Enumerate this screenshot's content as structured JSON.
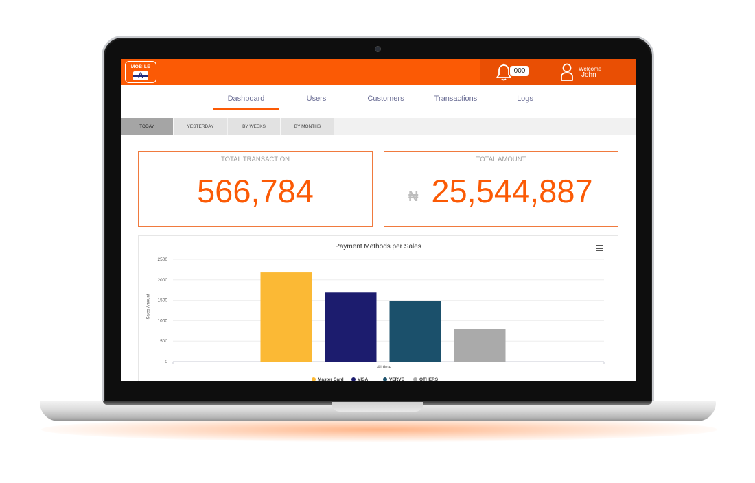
{
  "header": {
    "logo_text": "MOBILE",
    "logo_letter": "A",
    "notification_count": "000",
    "welcome": "Welcome",
    "username": "John"
  },
  "nav": {
    "items": [
      "Dashboard",
      "Users",
      "Customers",
      "Transactions",
      "Logs"
    ],
    "active": "Dashboard"
  },
  "filters": {
    "items": [
      "TODAY",
      "YESTERDAY",
      "BY WEEKS",
      "BY MONTHS"
    ],
    "active": "TODAY"
  },
  "stats": {
    "total_transaction_label": "TOTAL TRANSACTION",
    "total_transaction_value": "566,784",
    "total_amount_label": "TOTAL AMOUNT",
    "currency_symbol": "₦",
    "total_amount_value": "25,544,887"
  },
  "colors": {
    "brand": "#fb5a05",
    "nav_text": "#6c6f96"
  },
  "icons": [
    "bell-icon",
    "user-icon",
    "hamburger-menu-icon"
  ],
  "chart_data": {
    "type": "bar",
    "title": "Payment Methods per Sales",
    "xlabel": "",
    "ylabel": "Sales Amount",
    "categories": [
      "Airtime"
    ],
    "ylim": [
      0,
      2500
    ],
    "yticks": [
      0,
      500,
      1000,
      1500,
      2000,
      2500
    ],
    "grid": true,
    "legend_position": "bottom",
    "series": [
      {
        "name": "Master Card",
        "values": [
          2180
        ],
        "color": "#fbb935"
      },
      {
        "name": "VISA",
        "values": [
          1690
        ],
        "color": "#1c1c6e"
      },
      {
        "name": "VERVE",
        "values": [
          1490
        ],
        "color": "#1b506b"
      },
      {
        "name": "OTHERS",
        "values": [
          790
        ],
        "color": "#aaaaaa"
      }
    ]
  }
}
